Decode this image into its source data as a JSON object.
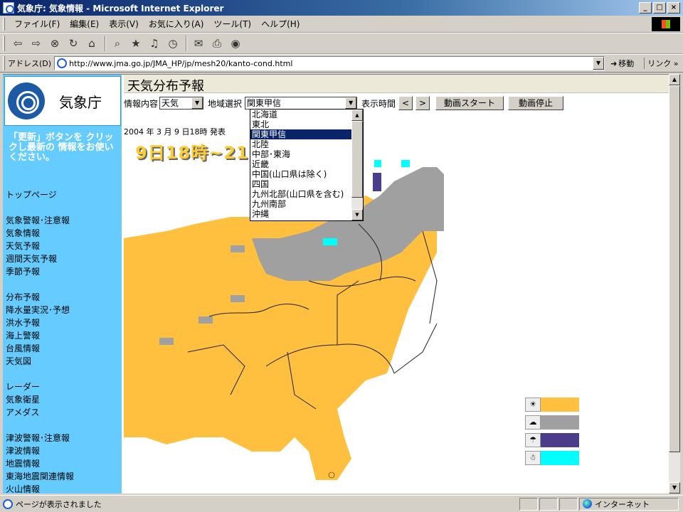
{
  "window": {
    "title": "気象庁: 気象情報 - Microsoft Internet Explorer",
    "controls": [
      "_",
      "□",
      "×"
    ]
  },
  "menu": [
    "ファイル(F)",
    "編集(E)",
    "表示(V)",
    "お気に入り(A)",
    "ツール(T)",
    "ヘルプ(H)"
  ],
  "address": {
    "label": "アドレス(D)",
    "url": "http://www.jma.go.jp/JMA_HP/jp/mesh20/kanto-cond.html",
    "go": "移動",
    "links": "リンク »"
  },
  "sidebar": {
    "logo_text": "気象庁",
    "update_note": "「更新」ボタンを クリックし最新の 情報をお使いください。",
    "nav": {
      "top": "トップページ",
      "warnings": "気象警報･注意報",
      "weather_info": "気象情報",
      "forecast": "天気予報",
      "weekly": "週間天気予報",
      "seasonal": "季節予報",
      "distribution": "分布予報",
      "precip": "降水量実況･予想",
      "flood": "洪水予報",
      "marine": "海上警報",
      "typhoon": "台風情報",
      "weather_map": "天気図",
      "radar": "レーダー",
      "satellite": "気象衛星",
      "amedas": "アメダス",
      "tsunami_warn": "津波警報･注意報",
      "tsunami_info": "津波情報",
      "earthquake": "地震情報",
      "tokai": "東海地震関連情報",
      "volcano": "火山情報"
    }
  },
  "content": {
    "title": "天気分布予報",
    "info_label": "情報内容",
    "info_value": "天気",
    "region_label": "地域選択",
    "region_value": "関東甲信",
    "time_label": "表示時間",
    "prev": "<",
    "next": ">",
    "play": "動画スタート",
    "stop": "動画停止",
    "issued": "2004 年 3 月 9 日18時 発表",
    "banner": "9日18時~21時"
  },
  "region_options": [
    "北海道",
    "東北",
    "関東甲信",
    "北陸",
    "中部･東海",
    "近畿",
    "中国(山口県は除く)",
    "四国",
    "九州北部(山口県を含む)",
    "九州南部",
    "沖縄"
  ],
  "region_selected_index": 2,
  "legend": [
    {
      "icon": "sun-icon",
      "glyph": "☀",
      "color": "#ffc040"
    },
    {
      "icon": "cloud-icon",
      "glyph": "☁",
      "color": "#a0a0a0"
    },
    {
      "icon": "rain-icon",
      "glyph": "☂",
      "color": "#4b3c8c"
    },
    {
      "icon": "snow-icon",
      "glyph": "☃",
      "color": "#00ffff"
    }
  ],
  "colors": {
    "sunny": "#ffc040",
    "cloudy": "#a0a0a0",
    "rain": "#4b3c8c",
    "snow": "#00ffff",
    "sidebar": "#66ccff"
  },
  "status": {
    "text": "ページが表示されました",
    "zone": "インターネット"
  }
}
